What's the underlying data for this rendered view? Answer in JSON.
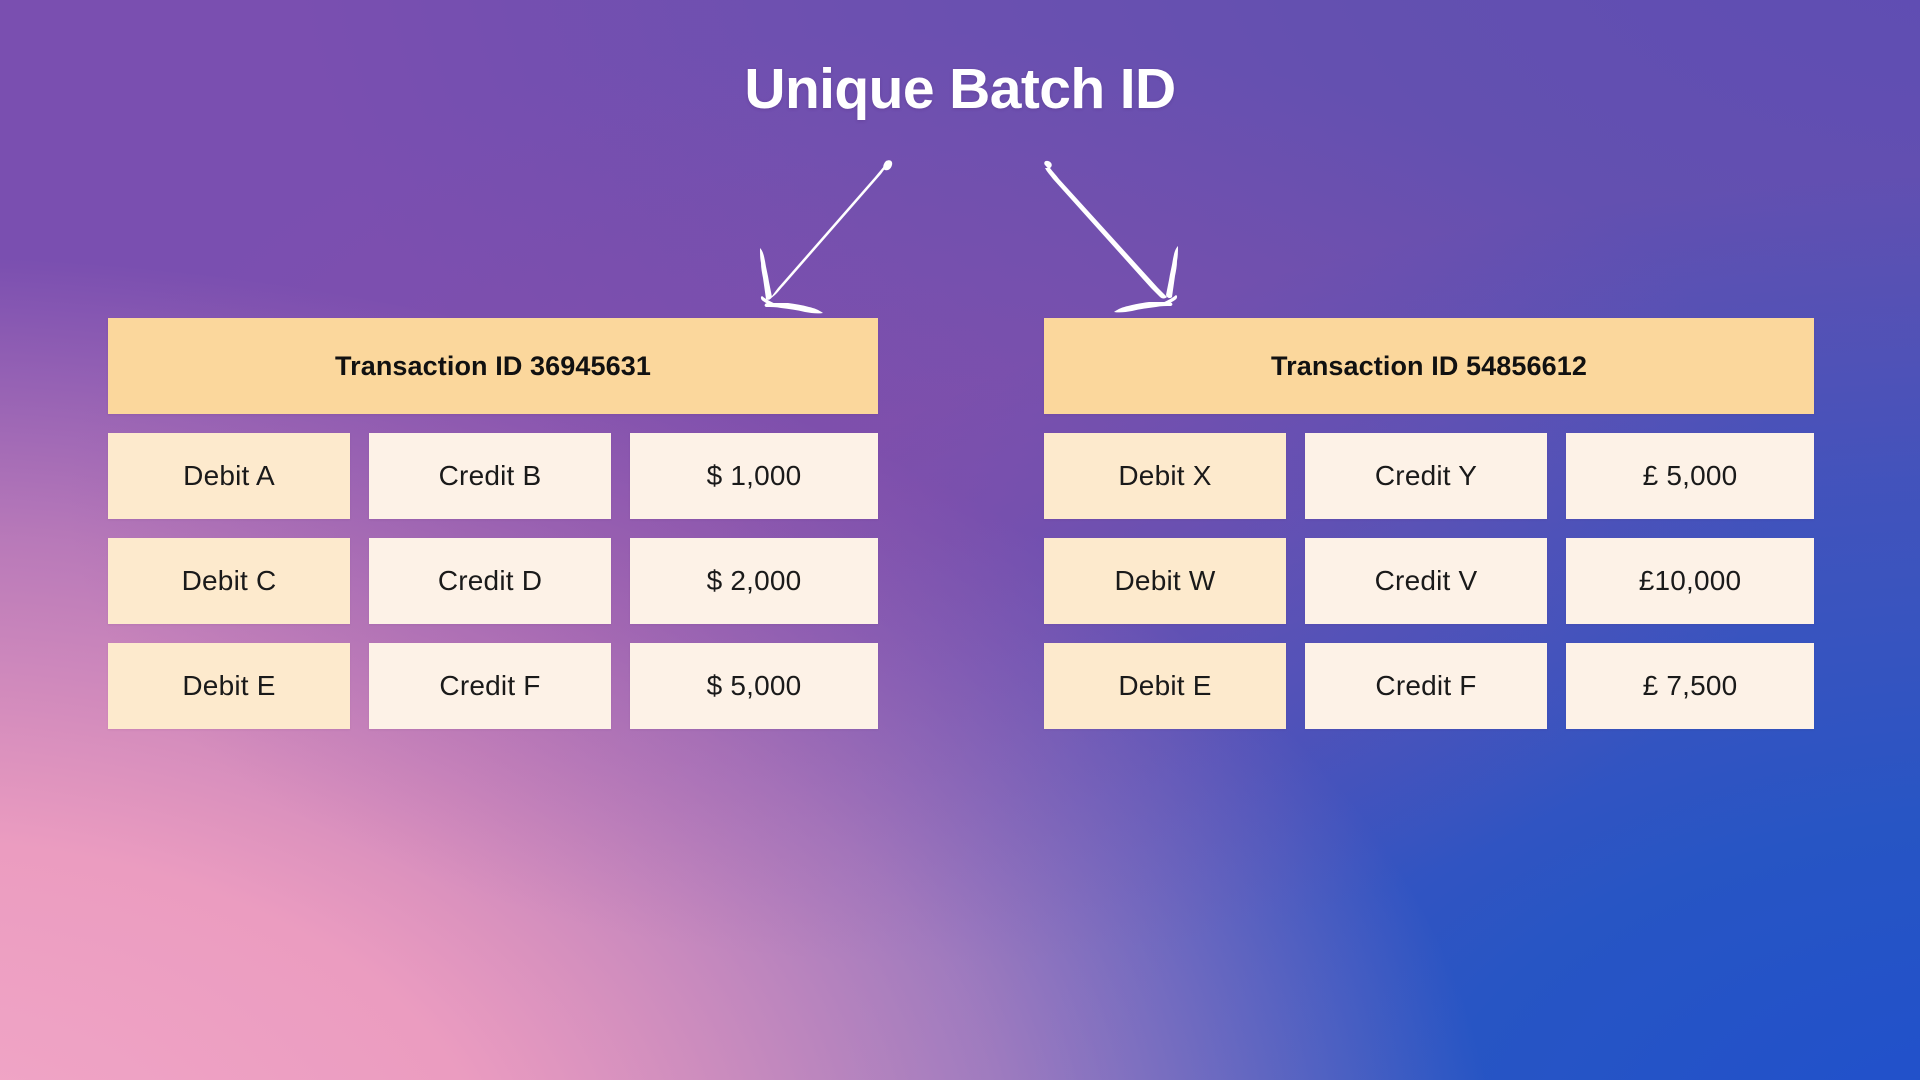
{
  "page": {
    "title": "Unique Batch ID"
  },
  "colors": {
    "bg_top_left": "#dc4480",
    "bg_top_right": "#6350b0",
    "bg_bottom_right": "#2755c4",
    "bg_bottom_left": "#eb9cc0",
    "header_bg": "#fbd79c",
    "cell_debit_bg": "#fdeacd",
    "cell_bg": "#fdf2e7",
    "title_color": "#ffffff",
    "arrow_color": "#ffffff",
    "text_color": "#111111"
  },
  "annotations": {
    "arrow_left_name": "arrow-to-left-transaction",
    "arrow_right_name": "arrow-to-right-transaction"
  },
  "tables": [
    {
      "id": "left",
      "header": "Transaction ID 36945631",
      "rows": [
        {
          "debit": "Debit A",
          "credit": "Credit B",
          "amount": "$ 1,000"
        },
        {
          "debit": "Debit C",
          "credit": "Credit D",
          "amount": "$ 2,000"
        },
        {
          "debit": "Debit E",
          "credit": "Credit F",
          "amount": "$ 5,000"
        }
      ]
    },
    {
      "id": "right",
      "header": "Transaction ID 54856612",
      "rows": [
        {
          "debit": "Debit X",
          "credit": "Credit Y",
          "amount": "£ 5,000"
        },
        {
          "debit": "Debit W",
          "credit": "Credit V",
          "amount": "£10,000"
        },
        {
          "debit": "Debit E",
          "credit": "Credit F",
          "amount": "£ 7,500"
        }
      ]
    }
  ]
}
